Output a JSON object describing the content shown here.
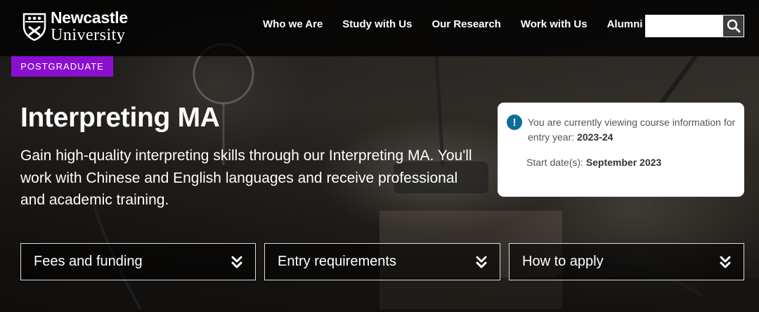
{
  "header": {
    "logo": {
      "line1": "Newcastle",
      "line2": "University",
      "icon": "shield-crest-icon"
    },
    "nav": [
      {
        "label": "Who we Are"
      },
      {
        "label": "Study with Us"
      },
      {
        "label": "Our Research"
      },
      {
        "label": "Work with Us"
      },
      {
        "label": "Alumni"
      }
    ],
    "search": {
      "value": "",
      "icon": "search-icon"
    }
  },
  "hero": {
    "badge": "POSTGRADUATE",
    "title": "Interpreting MA",
    "subtitle": "Gain high-quality interpreting skills through our Interpreting MA. You'll work with Chinese and English languages and receive professional and academic training."
  },
  "info": {
    "icon": "info-icon",
    "viewing_text": "You are currently viewing course information for entry year:",
    "entry_year": "2023-24",
    "start_label": "Start date(s):",
    "start_value": "September 2023"
  },
  "accordions": [
    {
      "label": "Fees and funding",
      "icon": "double-chevron-down-icon"
    },
    {
      "label": "Entry requirements",
      "icon": "double-chevron-down-icon"
    },
    {
      "label": "How to apply",
      "icon": "double-chevron-down-icon"
    }
  ],
  "colors": {
    "badge": "#8a0fd1",
    "info_icon": "#0e6c9a",
    "nav_background": "#000000"
  }
}
